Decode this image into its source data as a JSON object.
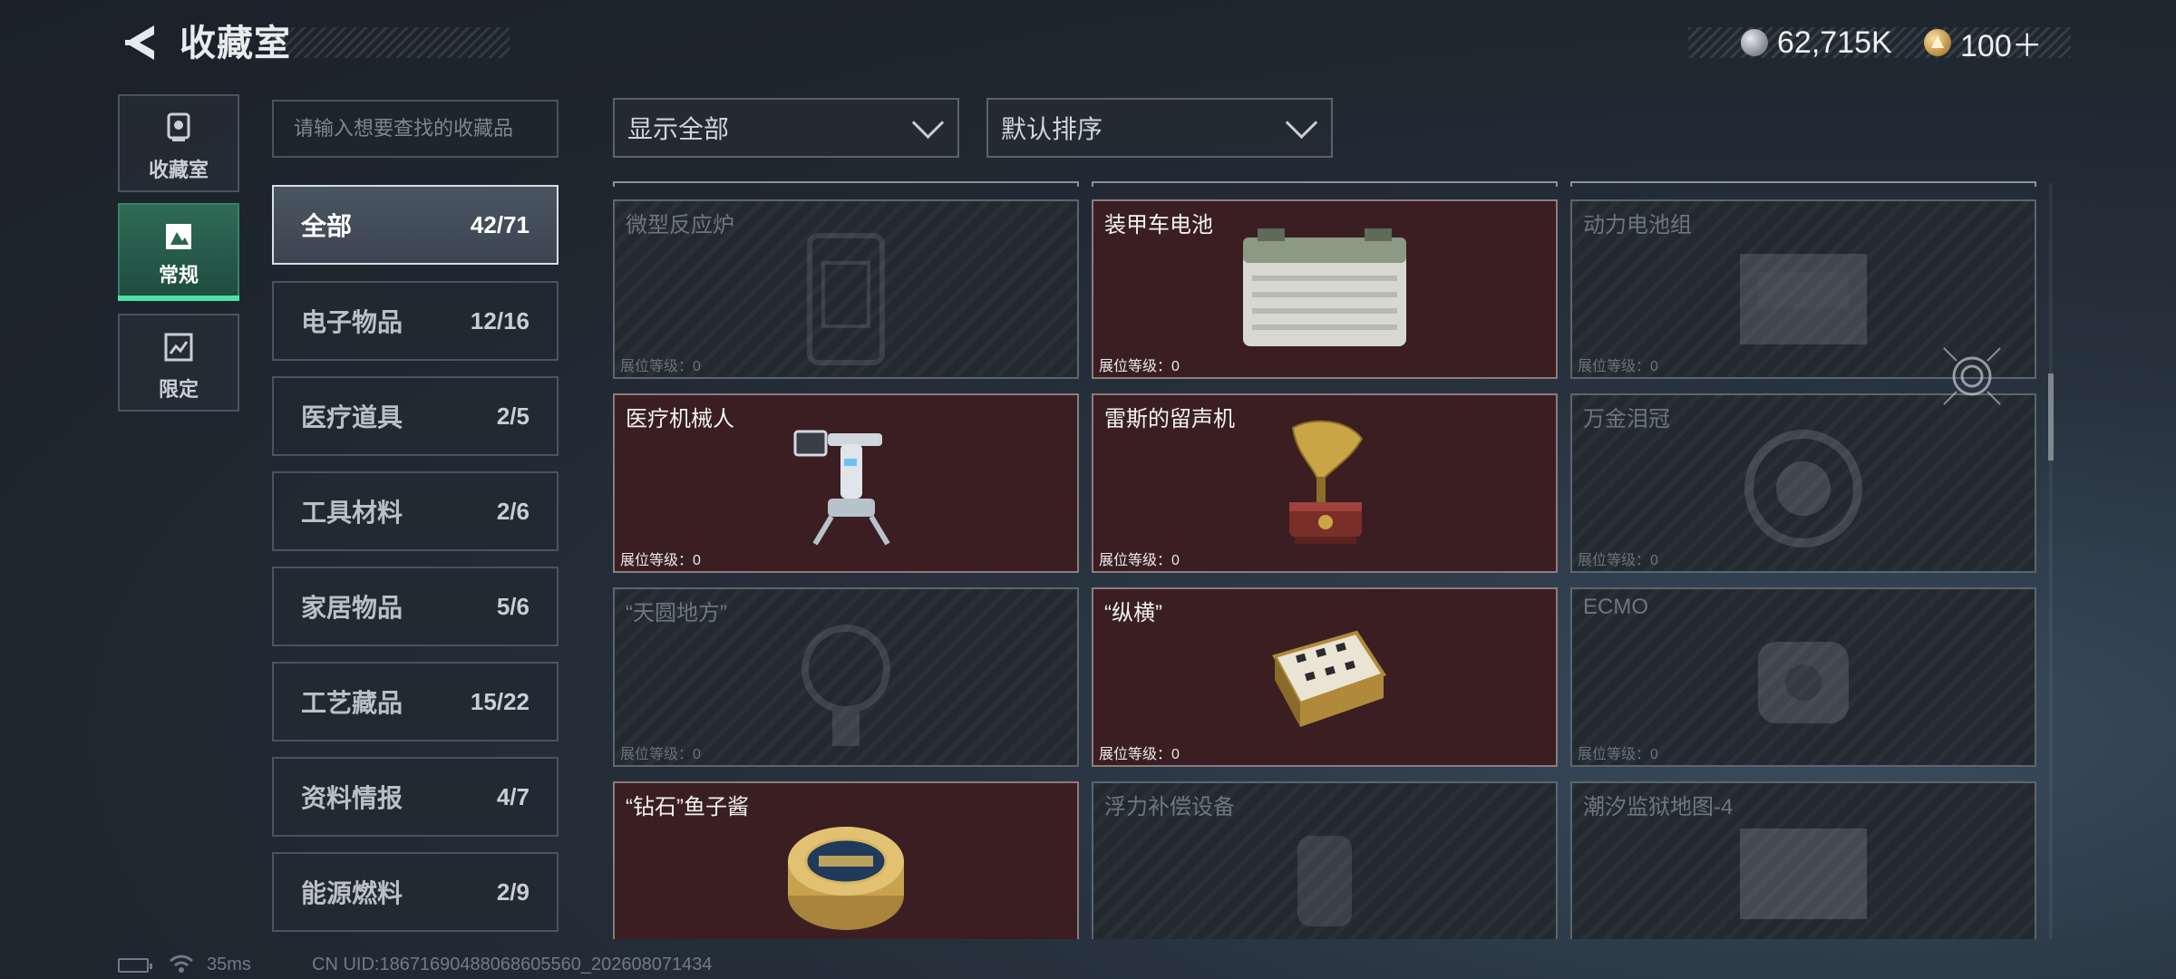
{
  "header": {
    "title": "收藏室",
    "currency_silver": "62,715K",
    "currency_gold": "100＋"
  },
  "rail": {
    "items": [
      {
        "label": "收藏室",
        "icon": "trophy-icon"
      },
      {
        "label": "常规",
        "icon": "image-icon",
        "active": true
      },
      {
        "label": "限定",
        "icon": "image-icon"
      }
    ]
  },
  "search": {
    "placeholder": "请输入想要查找的收藏品"
  },
  "categories": [
    {
      "name": "全部",
      "count": "42/71",
      "active": true
    },
    {
      "name": "电子物品",
      "count": "12/16"
    },
    {
      "name": "医疗道具",
      "count": "2/5"
    },
    {
      "name": "工具材料",
      "count": "2/6"
    },
    {
      "name": "家居物品",
      "count": "5/6"
    },
    {
      "name": "工艺藏品",
      "count": "15/22"
    },
    {
      "name": "资料情报",
      "count": "4/7"
    },
    {
      "name": "能源燃料",
      "count": "2/9"
    }
  ],
  "filters": {
    "show": "显示全部",
    "sort": "默认排序"
  },
  "items": [
    {
      "title": "微型反应炉",
      "level": "展位等级：0",
      "owned": false,
      "icon": "reactor-icon"
    },
    {
      "title": "装甲车电池",
      "level": "展位等级：0",
      "owned": true,
      "icon": "battery-icon"
    },
    {
      "title": "动力电池组",
      "level": "展位等级：0",
      "owned": false,
      "icon": "battery-pack-icon"
    },
    {
      "title": "医疗机械人",
      "level": "展位等级：0",
      "owned": true,
      "icon": "medical-robot-icon"
    },
    {
      "title": "雷斯的留声机",
      "level": "展位等级：0",
      "owned": true,
      "icon": "gramophone-icon"
    },
    {
      "title": "万金泪冠",
      "level": "展位等级：0",
      "owned": false,
      "icon": "crown-icon"
    },
    {
      "title": "“天圆地方”",
      "level": "展位等级：0",
      "owned": false,
      "icon": "armillary-icon"
    },
    {
      "title": "“纵横”",
      "level": "展位等级：0",
      "owned": true,
      "icon": "chessboard-icon"
    },
    {
      "title": "ECMO",
      "level": "展位等级：0",
      "owned": false,
      "icon": "ecmo-icon"
    },
    {
      "title": "“钻石”鱼子酱",
      "level": "",
      "owned": true,
      "icon": "caviar-tin-icon"
    },
    {
      "title": "浮力补偿设备",
      "level": "",
      "owned": false,
      "icon": "buoyancy-icon"
    },
    {
      "title": "潮汐监狱地图-4",
      "level": "",
      "owned": false,
      "icon": "map-icon"
    }
  ],
  "status": {
    "ping": "35ms",
    "uid": "CN UID:18671690488068605560_202608071434"
  }
}
